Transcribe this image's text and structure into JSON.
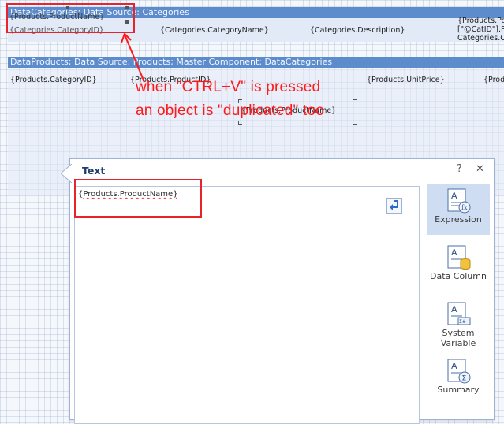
{
  "band_categories": {
    "header": "DataCategories; Data Source: Categories",
    "cells": [
      "{Categories.CategoryID}",
      "{Categories.CategoryName}",
      "{Categories.Description}",
      "{Products.Po",
      "[\"@CatID\"].P",
      "Categories.C"
    ],
    "pasted_copy": "{Products.ProductName}"
  },
  "band_products": {
    "header": "DataProducts; Data Source: Products; Master Component: DataCategories",
    "cells": [
      "{Products.CategoryID}",
      "{Products.ProductID}",
      "{Products.UnitPrice}",
      "{Prod"
    ],
    "selected_cell": "{Products.ProductName}"
  },
  "annotation": {
    "line1": "when \"CTRL+V\" is pressed",
    "line2": "an object is \"duplicated\" too",
    "color": "#ff1a1a"
  },
  "dialog": {
    "title": "Text",
    "help_label": "?",
    "close_label": "✕",
    "expression": "{Products.ProductName}",
    "insert_icon": "insert-arrow-icon",
    "side_items": [
      {
        "label": "Expression",
        "icon": "expression-icon"
      },
      {
        "label": "Data Column",
        "icon": "data-column-icon"
      },
      {
        "label": "System Variable",
        "icon": "system-variable-icon"
      },
      {
        "label": "Summary",
        "icon": "summary-icon"
      }
    ]
  }
}
